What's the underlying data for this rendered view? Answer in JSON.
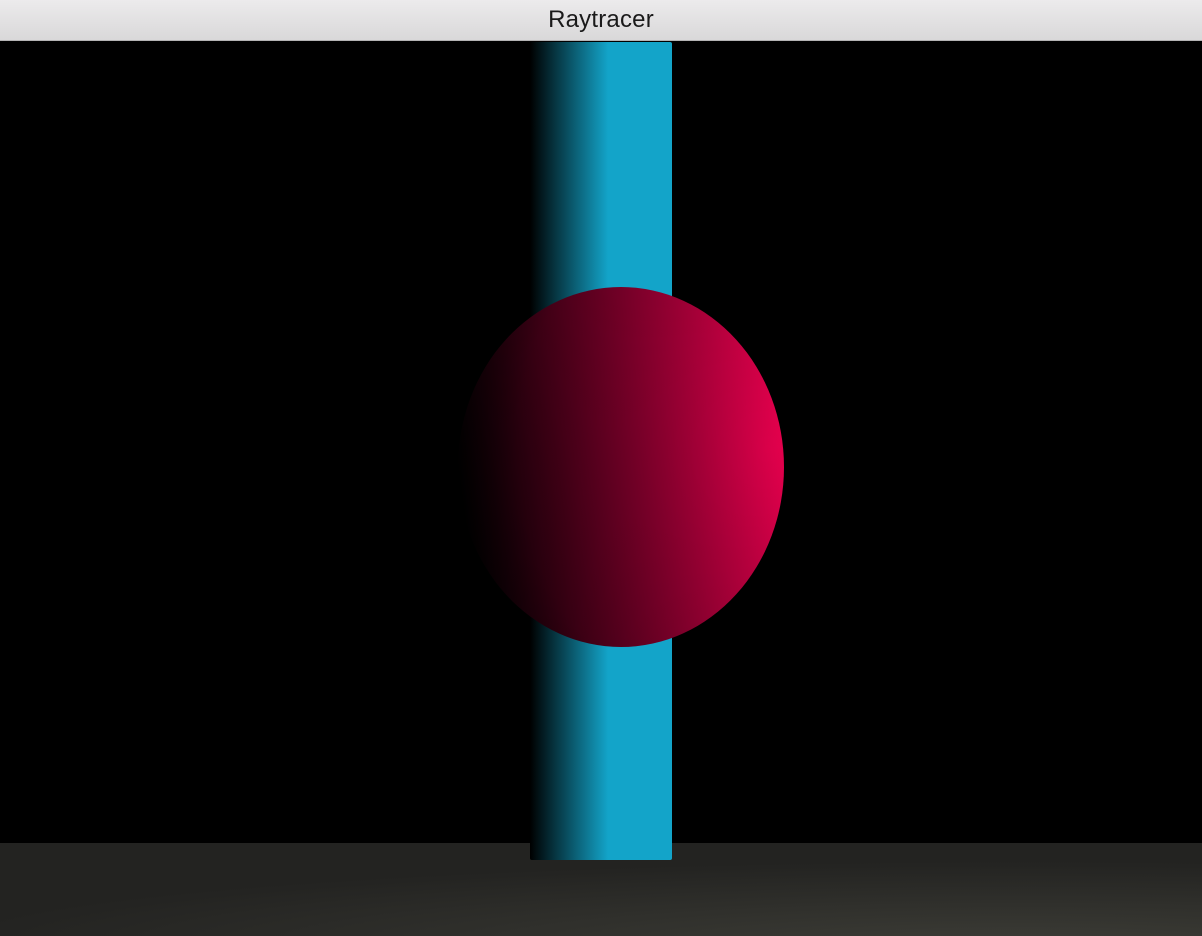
{
  "window": {
    "title": "Raytracer"
  },
  "scene": {
    "background": "#000000",
    "cylinder": {
      "color_lit": "#13a4c9",
      "color_shadow": "#000000"
    },
    "sphere": {
      "color_lit": "#e8004e",
      "color_shadow": "#000000"
    },
    "floor": {
      "color_near": "#3c3c36",
      "color_far": "#232321"
    }
  }
}
